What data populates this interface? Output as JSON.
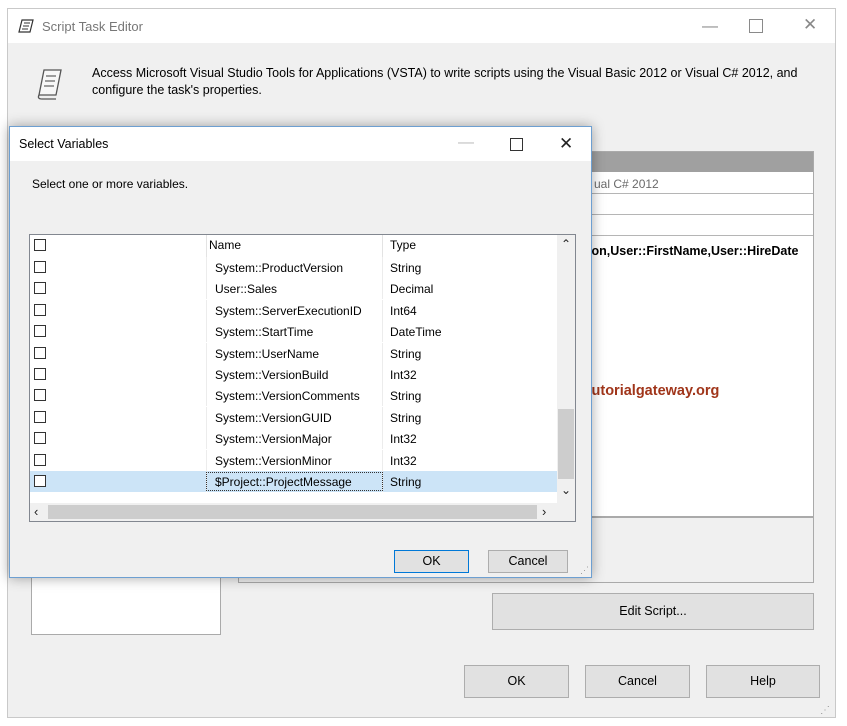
{
  "main_window": {
    "title": "Script Task Editor",
    "description": "Access Microsoft Visual Studio Tools for Applications (VSTA) to write scripts using the Visual Basic 2012 or Visual C# 2012, and configure the task's properties.",
    "props_language_fragment": "ual C# 2012",
    "props_variables_fragment": "ion,User::FirstName,User::HireDate",
    "watermark": "©tutorialgateway.org",
    "edit_script_label": "Edit Script...",
    "ok_label": "OK",
    "cancel_label": "Cancel",
    "help_label": "Help",
    "minimize_glyph": "—",
    "close_glyph": "✕"
  },
  "select_variables": {
    "title": "Select Variables",
    "instruction": "Select one or more variables.",
    "columns": {
      "name": "Name",
      "type": "Type"
    },
    "rows": [
      {
        "name": "System::ProductVersion",
        "type": "String",
        "checked": false,
        "selected": false
      },
      {
        "name": "User::Sales",
        "type": "Decimal",
        "checked": false,
        "selected": false
      },
      {
        "name": "System::ServerExecutionID",
        "type": "Int64",
        "checked": false,
        "selected": false
      },
      {
        "name": "System::StartTime",
        "type": "DateTime",
        "checked": false,
        "selected": false
      },
      {
        "name": "System::UserName",
        "type": "String",
        "checked": false,
        "selected": false
      },
      {
        "name": "System::VersionBuild",
        "type": "Int32",
        "checked": false,
        "selected": false
      },
      {
        "name": "System::VersionComments",
        "type": "String",
        "checked": false,
        "selected": false
      },
      {
        "name": "System::VersionGUID",
        "type": "String",
        "checked": false,
        "selected": false
      },
      {
        "name": "System::VersionMajor",
        "type": "Int32",
        "checked": false,
        "selected": false
      },
      {
        "name": "System::VersionMinor",
        "type": "Int32",
        "checked": false,
        "selected": false
      },
      {
        "name": "$Project::ProjectMessage",
        "type": "String",
        "checked": false,
        "selected": true
      }
    ],
    "ok_label": "OK",
    "cancel_label": "Cancel",
    "minimize_glyph": "—",
    "close_glyph": "✕",
    "scroll_up_glyph": "⌃",
    "scroll_down_glyph": "⌄",
    "scroll_left_glyph": "‹",
    "scroll_right_glyph": "›",
    "icons": [
      "script-task-icon",
      "minimize-icon",
      "maximize-icon",
      "close-icon",
      "resize-grip-icon"
    ]
  }
}
